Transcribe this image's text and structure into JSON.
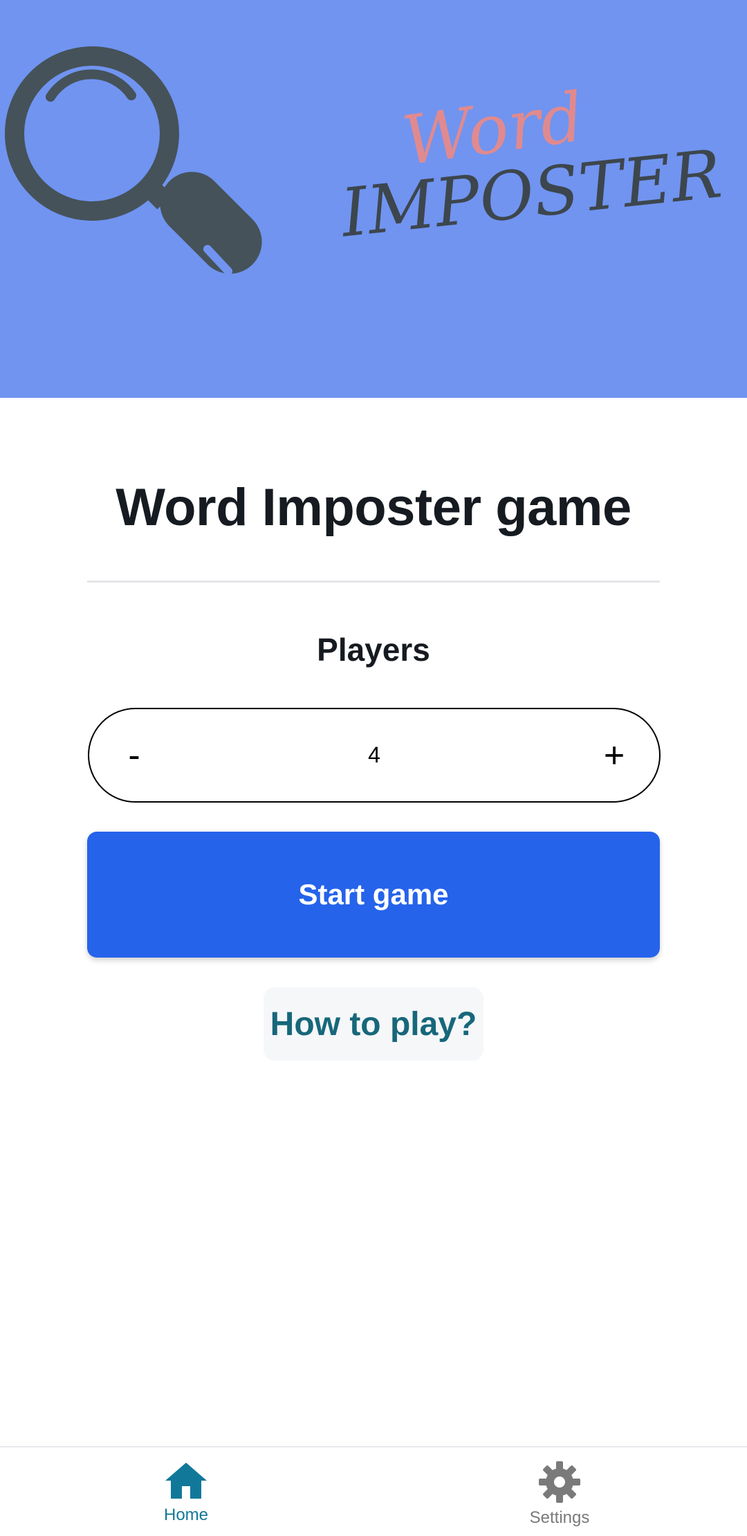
{
  "hero": {
    "logo_word": "Word",
    "logo_imposter": "IMPOSTER",
    "icon": "magnifying-glass-icon",
    "background_color": "#7094f0"
  },
  "main": {
    "title": "Word Imposter game",
    "players_label": "Players",
    "stepper": {
      "minus_label": "-",
      "value": "4",
      "plus_label": "+"
    },
    "start_button": "Start game",
    "how_to_play_button": "How to play?",
    "accent_color": "#2563eb"
  },
  "navbar": {
    "items": [
      {
        "label": "Home",
        "icon": "home-icon",
        "active": true,
        "color": "#12789a"
      },
      {
        "label": "Settings",
        "icon": "gear-icon",
        "active": false,
        "color": "#7a7a7a"
      }
    ]
  }
}
